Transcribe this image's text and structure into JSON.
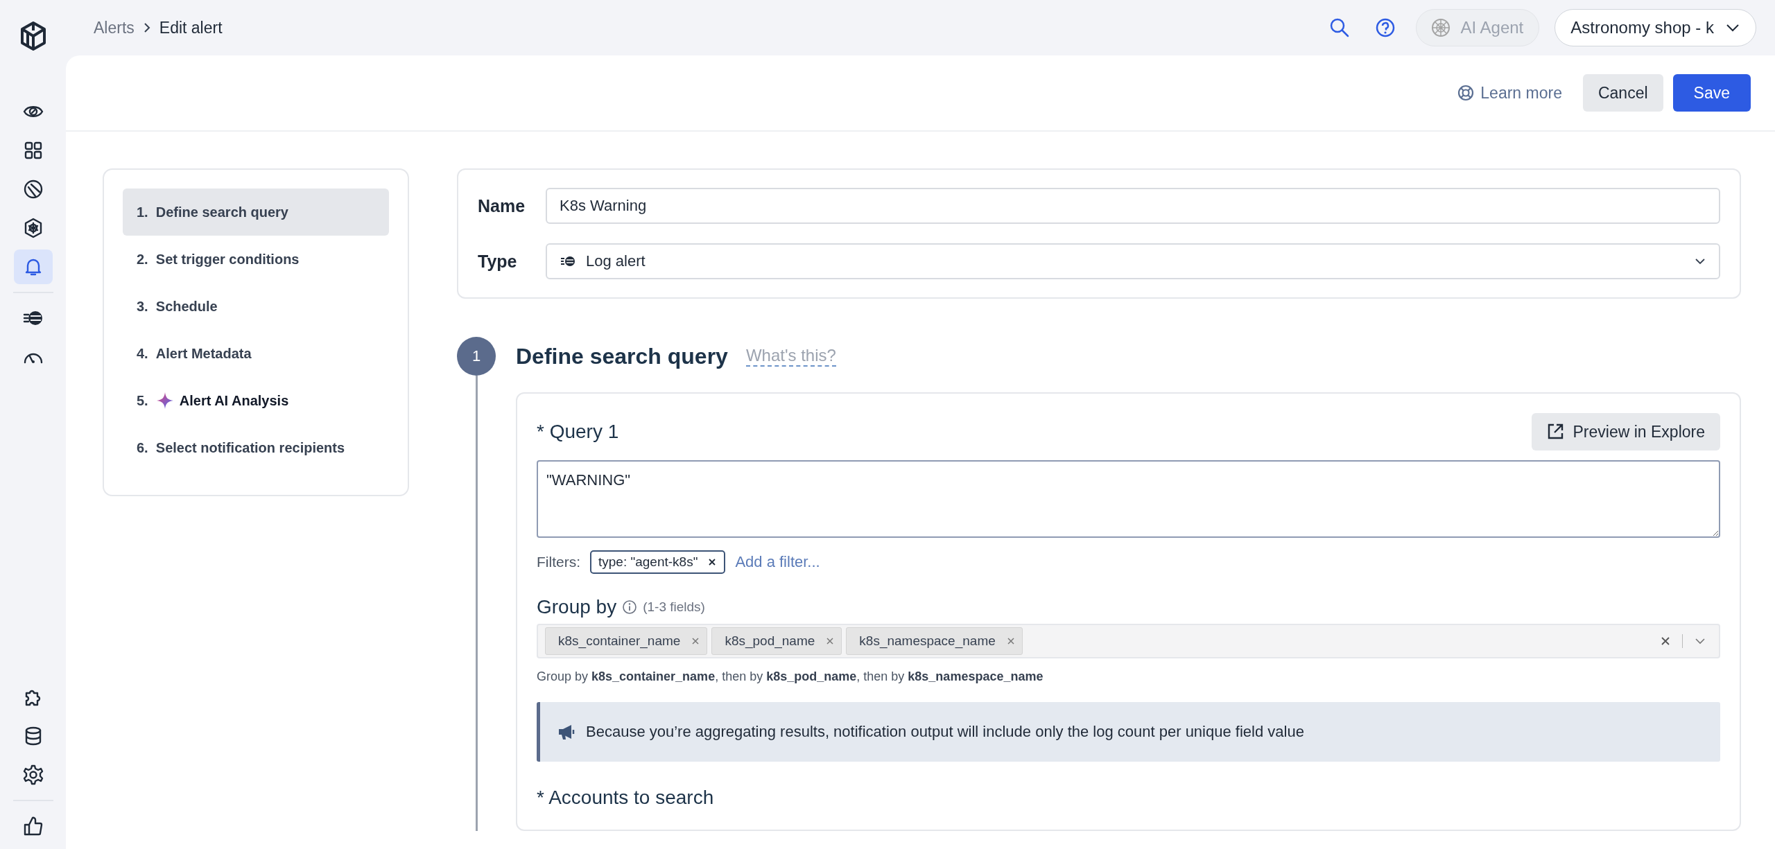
{
  "breadcrumb": {
    "parent": "Alerts",
    "current": "Edit alert"
  },
  "header": {
    "ai_agent": "AI Agent",
    "account": "Astronomy shop - k"
  },
  "nav_top": [
    [
      {
        "kind": "eye",
        "selected": false
      },
      {
        "kind": "grid",
        "selected": false
      },
      {
        "kind": "disc",
        "selected": false
      },
      {
        "kind": "helm",
        "selected": false
      },
      {
        "kind": "bell",
        "selected": true
      }
    ],
    [
      {
        "kind": "logs",
        "selected": false
      },
      {
        "kind": "gauge",
        "selected": false
      }
    ]
  ],
  "nav_bottom": [
    [
      {
        "kind": "puzzle",
        "selected": false
      },
      {
        "kind": "database",
        "selected": false
      },
      {
        "kind": "gear",
        "selected": false
      }
    ],
    [
      {
        "kind": "thumb",
        "selected": false
      }
    ]
  ],
  "actions": {
    "learn_more": "Learn more",
    "cancel": "Cancel",
    "save": "Save"
  },
  "steps": [
    {
      "number": "1.",
      "label": "Define search query",
      "kind": "plain",
      "selected": true
    },
    {
      "number": "2.",
      "label": "Set trigger conditions",
      "kind": "plain",
      "selected": false
    },
    {
      "number": "3.",
      "label": "Schedule",
      "kind": "plain",
      "selected": false
    },
    {
      "number": "4.",
      "label": "Alert Metadata",
      "kind": "plain",
      "selected": false
    },
    {
      "number": "5.",
      "label": "Alert AI Analysis",
      "kind": "ai",
      "selected": false
    },
    {
      "number": "6.",
      "label": "Select notification recipients",
      "kind": "plain",
      "selected": false
    }
  ],
  "form": {
    "name_label": "Name",
    "name_value": "K8s Warning",
    "type_label": "Type",
    "type_value": "Log alert"
  },
  "section": {
    "number": "1",
    "title": "Define search query",
    "help_link": "What's this?"
  },
  "query": {
    "label": "* Query 1",
    "preview_button": "Preview in Explore",
    "value": "\"WARNING\"",
    "filters_label": "Filters:",
    "filters": [
      {
        "label": "type: \"agent-k8s\""
      }
    ],
    "add_filter": "Add a filter..."
  },
  "group_by": {
    "label": "Group by",
    "hint": "(1-3 fields)",
    "fields": [
      "k8s_container_name",
      "k8s_pod_name",
      "k8s_namespace_name"
    ],
    "summary": "Group by **k8s_container_name**, then by **k8s_pod_name**, then by **k8s_namespace_name**"
  },
  "notice": "Because you’re aggregating results, notification output will include only the log count per unique field value",
  "accounts_label": "* Accounts to search"
}
